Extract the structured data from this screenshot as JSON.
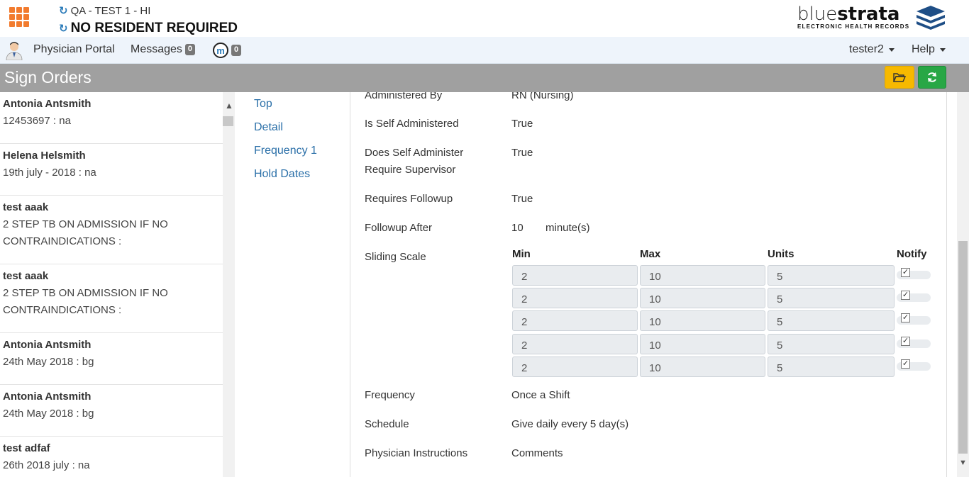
{
  "header": {
    "facility": "QA - TEST 1 - HI",
    "resident": "NO RESIDENT REQUIRED",
    "logo_brand_light": "blue",
    "logo_brand_bold": "strata",
    "logo_subtitle": "ELECTRONIC HEALTH RECORDS"
  },
  "nav": {
    "portal": "Physician Portal",
    "messages": "Messages",
    "messages_count": "0",
    "m_count": "0",
    "m_icon_letter": "m",
    "user": "tester2",
    "help": "Help"
  },
  "page": {
    "title": "Sign Orders"
  },
  "orders": [
    {
      "name": "Antonia Antsmith",
      "sub": "12453697 : na"
    },
    {
      "name": "Helena Helsmith",
      "sub": "19th july - 2018 : na"
    },
    {
      "name": "test aaak",
      "sub": "2 STEP TB ON ADMISSION IF NO CONTRAINDICATIONS :"
    },
    {
      "name": "test aaak",
      "sub": "2 STEP TB ON ADMISSION IF NO CONTRAINDICATIONS :"
    },
    {
      "name": "Antonia Antsmith",
      "sub": "24th May 2018 : bg"
    },
    {
      "name": "Antonia Antsmith",
      "sub": "24th May 2018 : bg"
    },
    {
      "name": "test adfaf",
      "sub": "26th 2018 july : na"
    }
  ],
  "sections": [
    "Top",
    "Detail",
    "Frequency 1",
    "Hold Dates"
  ],
  "details": {
    "administered_by_label": "Administered By",
    "administered_by_value": "RN (Nursing)",
    "self_admin_label": "Is Self Administered",
    "self_admin_value": "True",
    "self_admin_supervisor_label": "Does Self Administer Require Supervisor",
    "self_admin_supervisor_value": "True",
    "requires_followup_label": "Requires Followup",
    "requires_followup_value": "True",
    "followup_after_label": "Followup After",
    "followup_after_value": "10",
    "followup_after_unit": "minute(s)",
    "sliding_scale_label": "Sliding Scale",
    "frequency_label": "Frequency",
    "frequency_value": "Once a Shift",
    "schedule_label": "Schedule",
    "schedule_value": "Give daily every 5 day(s)",
    "instructions_label": "Physician Instructions",
    "instructions_value": "Comments"
  },
  "sliding_scale": {
    "headers": {
      "min": "Min",
      "max": "Max",
      "units": "Units",
      "notify": "Notify"
    },
    "rows": [
      {
        "min": "2",
        "max": "10",
        "units": "5",
        "notify": true
      },
      {
        "min": "2",
        "max": "10",
        "units": "5",
        "notify": true
      },
      {
        "min": "2",
        "max": "10",
        "units": "5",
        "notify": true
      },
      {
        "min": "2",
        "max": "10",
        "units": "5",
        "notify": true
      },
      {
        "min": "2",
        "max": "10",
        "units": "5",
        "notify": true
      }
    ]
  },
  "colors": {
    "accent_orange": "#f27b2e",
    "link_blue": "#2a6fa8",
    "title_bar": "#a0a0a0",
    "open_button": "#f7b900",
    "refresh_button": "#28a745"
  }
}
